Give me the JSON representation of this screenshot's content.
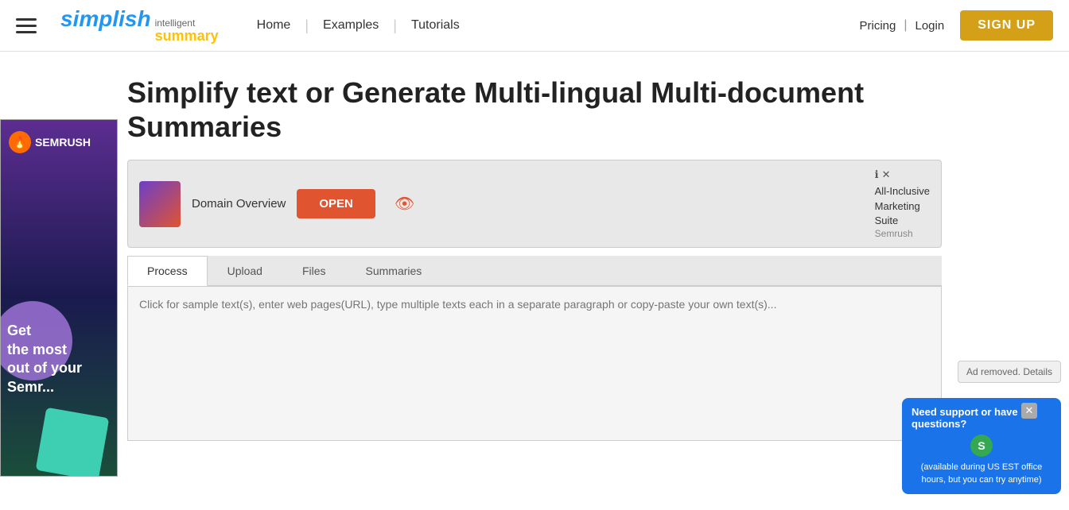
{
  "header": {
    "hamburger_label": "menu",
    "logo_simplish": "simplish",
    "logo_intelligent": "intelligent",
    "logo_summary": "summary",
    "nav": [
      {
        "label": "Home",
        "id": "home"
      },
      {
        "label": "Examples",
        "id": "examples"
      },
      {
        "label": "Tutorials",
        "id": "tutorials"
      }
    ],
    "top_right": {
      "pricing": "Pricing",
      "login": "Login",
      "signup": "SIGN UP"
    }
  },
  "hero": {
    "title": "Simplify text or Generate Multi-lingual Multi-document Summaries"
  },
  "ad_banner": {
    "label": "Domain Overview",
    "open_btn": "OPEN",
    "right_text": "All-Inclusive\nMarketing\nSuite",
    "right_brand": "Semrush"
  },
  "tabs": [
    {
      "label": "Process",
      "active": true
    },
    {
      "label": "Upload",
      "active": false
    },
    {
      "label": "Files",
      "active": false
    },
    {
      "label": "Summaries",
      "active": false
    }
  ],
  "text_area": {
    "placeholder": "Click for sample text(s), enter web pages(URL), type multiple texts each in a separate paragraph or copy-paste your own text(s)..."
  },
  "left_ad": {
    "brand": "SEMRUSH",
    "text": "Get\nthe most\nout of your\nSemr..."
  },
  "support": {
    "close": "×",
    "title": "Need support or have questions?",
    "avatar": "S",
    "subtext": "(available during US EST office hours, but you can try anytime)"
  },
  "ad_removed": {
    "label": "Ad removed. Details"
  }
}
